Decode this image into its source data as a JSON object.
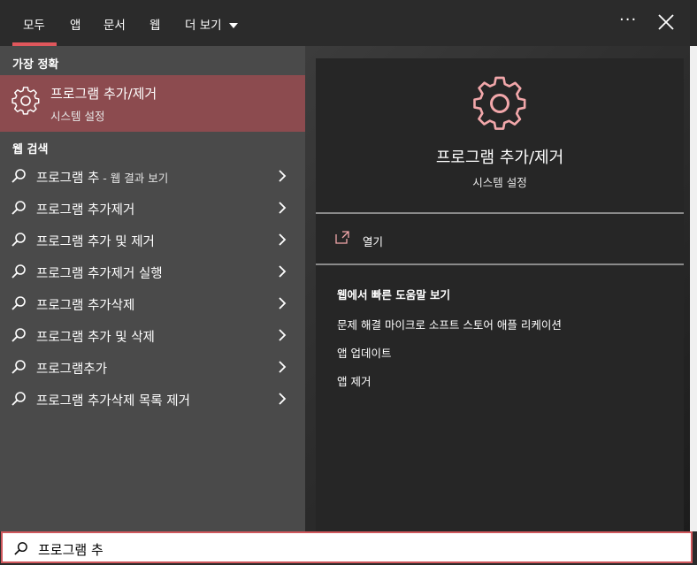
{
  "tabs": [
    {
      "label": "모두",
      "active": true
    },
    {
      "label": "앱"
    },
    {
      "label": "문서"
    },
    {
      "label": "웹"
    },
    {
      "label": "더 보기"
    }
  ],
  "header": {
    "more_label": "···"
  },
  "best_match": {
    "section_title": "가장 정확",
    "title": "프로그램 추가/제거",
    "subtitle": "시스템 설정"
  },
  "web_search": {
    "section_title": "웹 검색",
    "results": [
      {
        "label": "프로그램 추",
        "suffix": " - 웹 결과 보기"
      },
      {
        "label": "프로그램 추가제거"
      },
      {
        "label": "프로그램 추가 및 제거"
      },
      {
        "label": "프로그램 추가제거 실행"
      },
      {
        "label": "프로그램 추가삭제"
      },
      {
        "label": "프로그램 추가 및 삭제"
      },
      {
        "label": "프로그램추가"
      },
      {
        "label": "프로그램 추가삭제 목록 제거"
      }
    ]
  },
  "detail": {
    "title": "프로그램 추가/제거",
    "subtitle": "시스템 설정",
    "open_label": "열기",
    "web_help_title": "웹에서 빠른 도움말 보기",
    "web_links": [
      "문제 해결 마이크로 소프트 스토어 애플 리케이션",
      "앱 업데이트",
      "앱 제거"
    ]
  },
  "search": {
    "value": "프로그램 추"
  },
  "colors": {
    "accent": "#e0575c",
    "best_bg": "#8c4b4f",
    "left_bg": "#4a4a4a",
    "detail_bg": "#262626"
  }
}
